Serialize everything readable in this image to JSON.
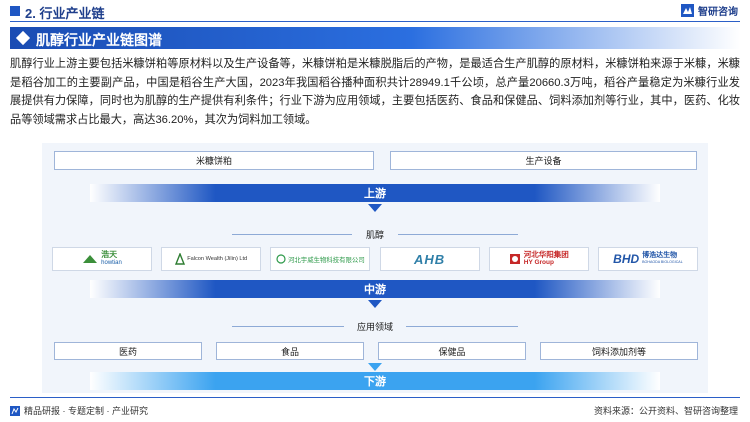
{
  "header": {
    "section_title": "2. 行业产业链",
    "brand_name": "智研咨询"
  },
  "banner": {
    "title": "肌醇行业产业链图谱"
  },
  "intro": "肌醇行业上游主要包括米糠饼粕等原材料以及生产设备等，米糠饼粕是米糠脱脂后的产物，是最适合生产肌醇的原材料，米糠饼粕来源于米糠，米糠是稻谷加工的主要副产品，中国是稻谷生产大国，2023年我国稻谷播种面积共计28949.1千公顷，总产量20660.3万吨，稻谷产量稳定为米糠行业发展提供有力保障，同时也为肌醇的生产提供有利条件；行业下游为应用领域，主要包括医药、食品和保健品、饲料添加剂等行业，其中，医药、化妆品等领域需求占比最大，高达36.20%，其次为饲料加工领域。",
  "diagram": {
    "upstream_items": [
      "米糠饼粕",
      "生产设备"
    ],
    "stage_upstream": "上游",
    "midstream_label": "肌醇",
    "companies": [
      {
        "cn": "浩天",
        "en": "howtian"
      },
      {
        "en": "Falcon Wealth (Jilin) Ltd"
      },
      {
        "cn": "河北宇威生物科技有限公司"
      },
      {
        "en": "AHB"
      },
      {
        "cn": "河北华阳集团",
        "en": "HY Group"
      },
      {
        "cn": "博浩达生物",
        "en": "BOHAODA BIOLOGICAL"
      }
    ],
    "stage_midstream": "中游",
    "downstream_label": "应用领域",
    "applications": [
      "医药",
      "食品",
      "保健品",
      "饲料添加剂等"
    ],
    "stage_downstream": "下游"
  },
  "footer": {
    "left_text": "精品研报 · 专题定制 · 产业研究",
    "source": "资料来源：公开资料、智研咨询整理"
  },
  "colors": {
    "primary": "#1f57c3",
    "downstream": "#3ba3f0",
    "panel": "#f1f5fb"
  }
}
